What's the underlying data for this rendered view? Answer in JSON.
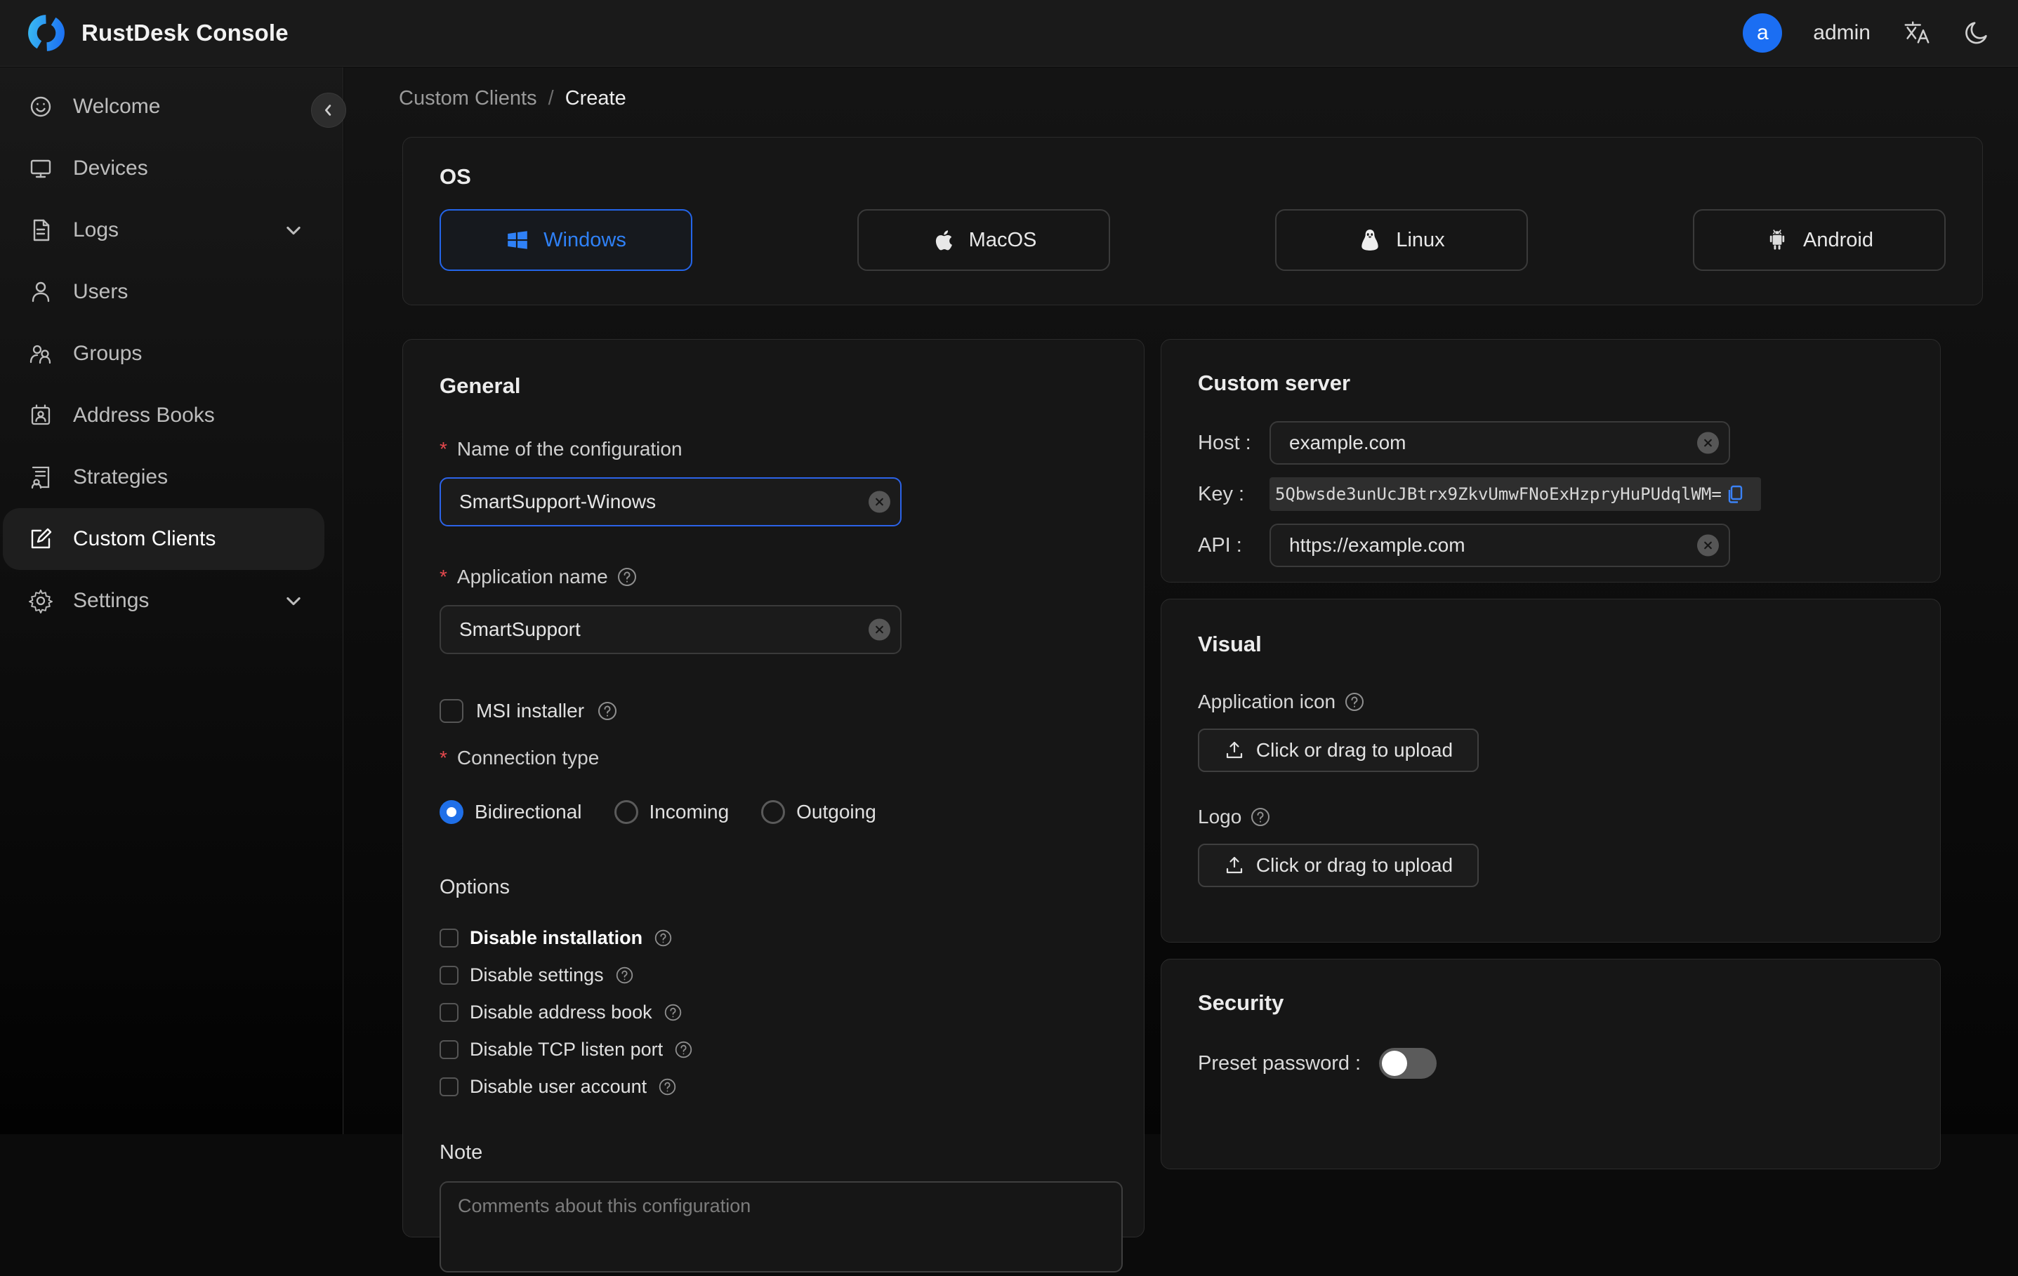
{
  "header": {
    "title": "RustDesk Console",
    "user": {
      "initial": "a",
      "name": "admin"
    }
  },
  "sidebar": {
    "items": [
      {
        "label": "Welcome"
      },
      {
        "label": "Devices"
      },
      {
        "label": "Logs"
      },
      {
        "label": "Users"
      },
      {
        "label": "Groups"
      },
      {
        "label": "Address Books"
      },
      {
        "label": "Strategies"
      },
      {
        "label": "Custom Clients"
      },
      {
        "label": "Settings"
      }
    ]
  },
  "breadcrumb": {
    "parent": "Custom Clients",
    "sep": "/",
    "current": "Create"
  },
  "os": {
    "heading": "OS",
    "options": [
      {
        "label": "Windows",
        "selected": true
      },
      {
        "label": "MacOS",
        "selected": false
      },
      {
        "label": "Linux",
        "selected": false
      },
      {
        "label": "Android",
        "selected": false
      }
    ]
  },
  "general": {
    "heading": "General",
    "name_label": "Name of the configuration",
    "name_value": "SmartSupport-Winows",
    "app_label": "Application name",
    "app_value": "SmartSupport",
    "msi_label": "MSI installer",
    "conn_label": "Connection type",
    "conn_options": [
      {
        "label": "Bidirectional",
        "selected": true
      },
      {
        "label": "Incoming",
        "selected": false
      },
      {
        "label": "Outgoing",
        "selected": false
      }
    ],
    "options_heading": "Options",
    "options": [
      {
        "label": "Disable installation"
      },
      {
        "label": "Disable settings"
      },
      {
        "label": "Disable address book"
      },
      {
        "label": "Disable TCP listen port"
      },
      {
        "label": "Disable user account"
      }
    ],
    "note_label": "Note",
    "note_placeholder": "Comments about this configuration"
  },
  "custom_server": {
    "heading": "Custom server",
    "host_label": "Host :",
    "host_value": "example.com",
    "key_label": "Key :",
    "key_value": "5Qbwsde3unUcJBtrx9ZkvUmwFNoExHzpryHuPUdqlWM=",
    "api_label": "API :",
    "api_value": "https://example.com"
  },
  "visual": {
    "heading": "Visual",
    "app_icon_label": "Application icon",
    "logo_label": "Logo",
    "upload_label": "Click or drag to upload"
  },
  "security": {
    "heading": "Security",
    "preset_label": "Preset password :"
  },
  "colors": {
    "accent": "#2f81f7",
    "avatar": "#1b6ef3",
    "danger": "#e5484d"
  }
}
